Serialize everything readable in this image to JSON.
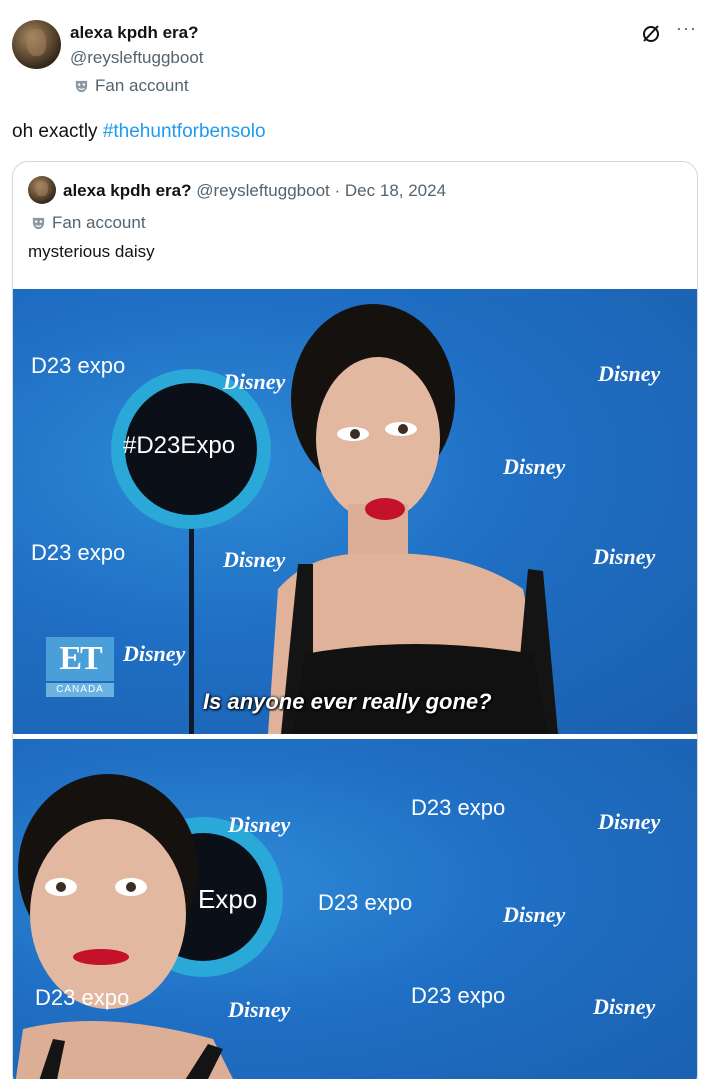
{
  "tweet": {
    "author": {
      "display_name": "alexa kpdh era?",
      "handle": "@reysleftuggboot",
      "badge": "Fan account"
    },
    "text_prefix": "oh exactly ",
    "hashtag": "#thehuntforbensolo"
  },
  "quote": {
    "author": {
      "display_name": "alexa kpdh era?",
      "handle": "@reysleftuggboot",
      "separator": "·",
      "date": "Dec 18, 2024",
      "badge": "Fan account"
    },
    "text": "mysterious daisy",
    "media": [
      {
        "caption": "Is anyone ever really gone?",
        "sign_text": "#D23Expo",
        "logo_letters": "ET",
        "logo_sub": "CANADA",
        "watermark_disney": "Disney",
        "watermark_expo": "D23 expo"
      },
      {
        "sign_text": "Expo",
        "watermark_disney": "Disney",
        "watermark_expo": "D23 expo"
      }
    ]
  },
  "icons": {
    "grok": "slash-circle-icon",
    "more": "more-dots-icon",
    "badge": "mask-icon"
  },
  "colors": {
    "link": "#1d9bf0",
    "secondary_text": "#536471",
    "backdrop_blue": "#1f6fc4"
  }
}
